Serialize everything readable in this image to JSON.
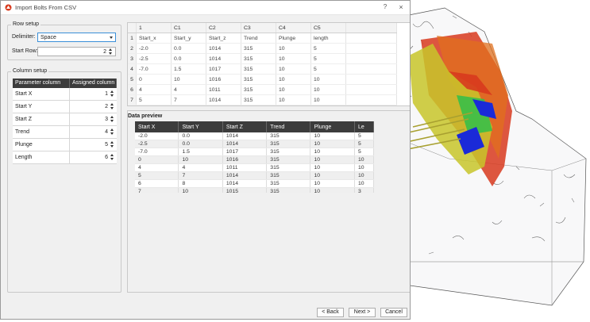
{
  "dialog": {
    "title": "Import Bolts From CSV",
    "help": "?",
    "close": "×"
  },
  "row_setup": {
    "title": "Row setup",
    "delimiter_label": "Delimiter:",
    "delimiter_value": "Space",
    "start_row_label": "Start Row:",
    "start_row_value": "2"
  },
  "column_setup": {
    "title": "Column setup",
    "headers": [
      "Parameter column",
      "Assigned column"
    ],
    "rows": [
      {
        "param": "Start X",
        "col": "1"
      },
      {
        "param": "Start Y",
        "col": "2"
      },
      {
        "param": "Start Z",
        "col": "3"
      },
      {
        "param": "Trend",
        "col": "4"
      },
      {
        "param": "Plunge",
        "col": "5"
      },
      {
        "param": "Length",
        "col": "6"
      }
    ]
  },
  "raw_table": {
    "headers": [
      "1",
      "C1",
      "C2",
      "C3",
      "C4",
      "C5"
    ],
    "rows": [
      [
        "Start_x",
        "Start_y",
        "Start_z",
        "Trend",
        "Plunge",
        "length"
      ],
      [
        "-2.0",
        "0.0",
        "1014",
        "315",
        "10",
        "5"
      ],
      [
        "-2.5",
        "0.0",
        "1014",
        "315",
        "10",
        "5"
      ],
      [
        "-7.0",
        "1.5",
        "1017",
        "315",
        "10",
        "5"
      ],
      [
        "0",
        "10",
        "1016",
        "315",
        "10",
        "10"
      ],
      [
        "4",
        "4",
        "1011",
        "315",
        "10",
        "10"
      ],
      [
        "5",
        "7",
        "1014",
        "315",
        "10",
        "10"
      ],
      [
        "6",
        "8",
        "1014",
        "315",
        "10",
        "10"
      ]
    ]
  },
  "preview": {
    "title": "Data preview",
    "headers": [
      "Start X",
      "Start Y",
      "Start Z",
      "Trend",
      "Plunge",
      "Le"
    ],
    "rows": [
      [
        "-2.0",
        "0.0",
        "1014",
        "315",
        "10",
        "5"
      ],
      [
        "-2.5",
        "0.0",
        "1014",
        "315",
        "10",
        "5"
      ],
      [
        "-7.0",
        "1.5",
        "1017",
        "315",
        "10",
        "5"
      ],
      [
        "0",
        "10",
        "1016",
        "315",
        "10",
        "10"
      ],
      [
        "4",
        "4",
        "1011",
        "315",
        "10",
        "10"
      ],
      [
        "5",
        "7",
        "1014",
        "315",
        "10",
        "10"
      ],
      [
        "6",
        "8",
        "1014",
        "315",
        "10",
        "10"
      ],
      [
        "7",
        "10",
        "1015",
        "315",
        "10",
        "3"
      ]
    ]
  },
  "buttons": {
    "back": "< Back",
    "next": "Next >",
    "cancel": "Cancel"
  },
  "colors": {
    "header_dark": "#3c3c3c",
    "focus_blue": "#3a8fd8",
    "model_yellow": "#c8c62a",
    "model_red": "#d83a1e",
    "model_blue": "#1a2ad8",
    "model_green": "#30c04a"
  }
}
